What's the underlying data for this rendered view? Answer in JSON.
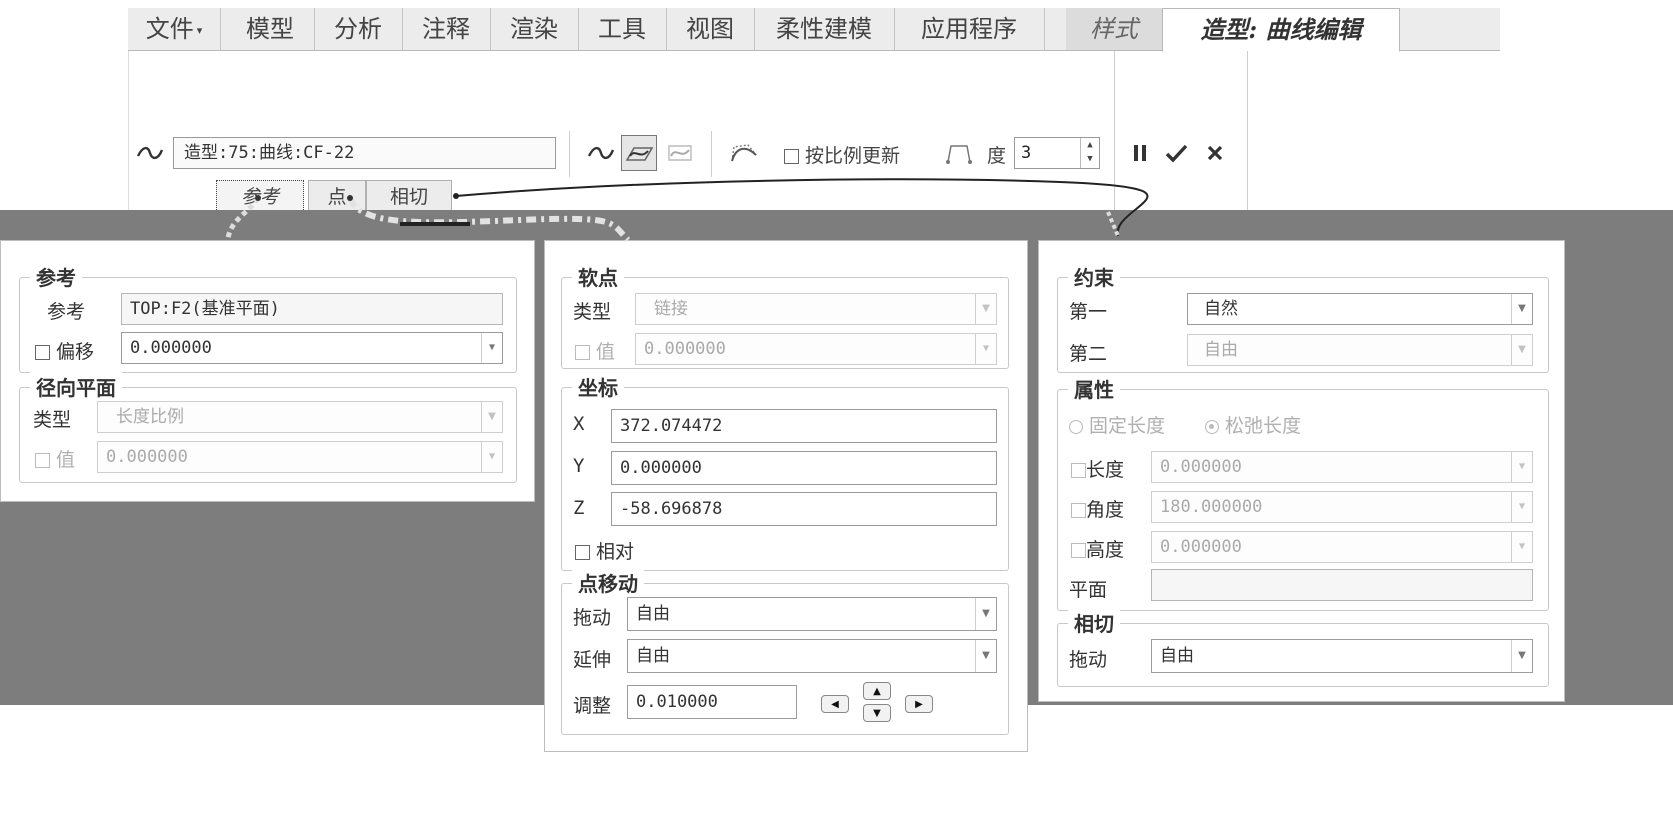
{
  "tabs": [
    {
      "label": "文件",
      "caret": "▾"
    },
    {
      "label": "模型"
    },
    {
      "label": "分析"
    },
    {
      "label": "注释"
    },
    {
      "label": "渲染"
    },
    {
      "label": "工具"
    },
    {
      "label": "视图"
    },
    {
      "label": "柔性建模"
    },
    {
      "label": "应用程序"
    },
    {
      "label": "样式"
    },
    {
      "label": "造型: 曲线编辑"
    }
  ],
  "ribbon": {
    "curve_name": "造型:75:曲线:CF-22",
    "scale_update_label": "按比例更新",
    "degree_label": "度",
    "degree_value": "3"
  },
  "subtabs": [
    "参考",
    "点",
    "相切"
  ],
  "panel_ref": {
    "group_ref_title": "参考",
    "ref_label": "参考",
    "ref_value": "TOP:F2(基准平面)",
    "offset_label": "偏移",
    "offset_value": "0.000000",
    "group_radial_title": "径向平面",
    "type_label": "类型",
    "type_value": "长度比例",
    "value_label": "值",
    "value_value": "0.000000"
  },
  "panel_point": {
    "group_soft_title": "软点",
    "type_label": "类型",
    "type_value": "链接",
    "value_label": "值",
    "value_value": "0.000000",
    "group_coord_title": "坐标",
    "x_label": "X",
    "x_value": "372.074472",
    "y_label": "Y",
    "y_value": "0.000000",
    "z_label": "Z",
    "z_value": "-58.696878",
    "relative_label": "相对",
    "group_move_title": "点移动",
    "drag_label": "拖动",
    "drag_value": "自由",
    "extend_label": "延伸",
    "extend_value": "自由",
    "adjust_label": "调整",
    "adjust_value": "0.010000"
  },
  "panel_tangent": {
    "group_constraint_title": "约束",
    "first_label": "第一",
    "first_value": "自然",
    "second_label": "第二",
    "second_value": "自由",
    "group_props_title": "属性",
    "fixed_length_label": "固定长度",
    "relaxed_length_label": "松弛长度",
    "length_label": "长度",
    "length_value": "0.000000",
    "angle_label": "角度",
    "angle_value": "180.000000",
    "height_label": "高度",
    "height_value": "0.000000",
    "plane_label": "平面",
    "plane_value": "",
    "group_tangent_title": "相切",
    "drag_label": "拖动",
    "drag_value": "自由"
  },
  "icons": {
    "curve": "tilde-curve-icon",
    "pause": "pause-icon",
    "ok": "check-icon",
    "cancel": "close-icon"
  },
  "colors": {
    "background_gray": "#7d7d7d",
    "tabbar": "#ececec",
    "panel_border": "#bdbdbd"
  }
}
